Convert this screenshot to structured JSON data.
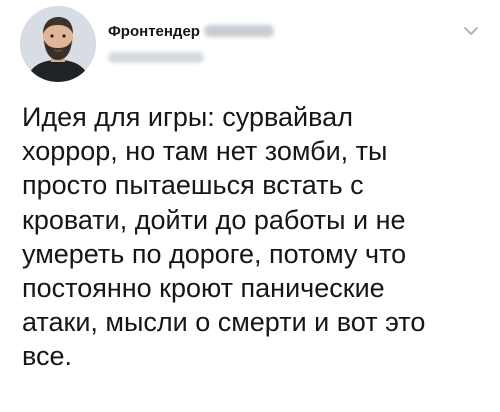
{
  "tweet": {
    "author": {
      "display_name": "Фронтендер",
      "avatar_icon": "user-avatar-icon"
    },
    "menu_icon": "chevron-down-icon",
    "text_lines": [
      "Идея для игры: сурвайвал",
      "хоррор, но там нет зомби, ты",
      "просто пытаешься встать с",
      "кровати, дойти до работы и не",
      "умереть по дороге, потому что",
      "постоянно кроют панические",
      "атаки, мысли о смерти и вот это",
      "все."
    ]
  },
  "colors": {
    "text": "#14171a",
    "muted": "#aab8c2",
    "background": "#ffffff"
  }
}
